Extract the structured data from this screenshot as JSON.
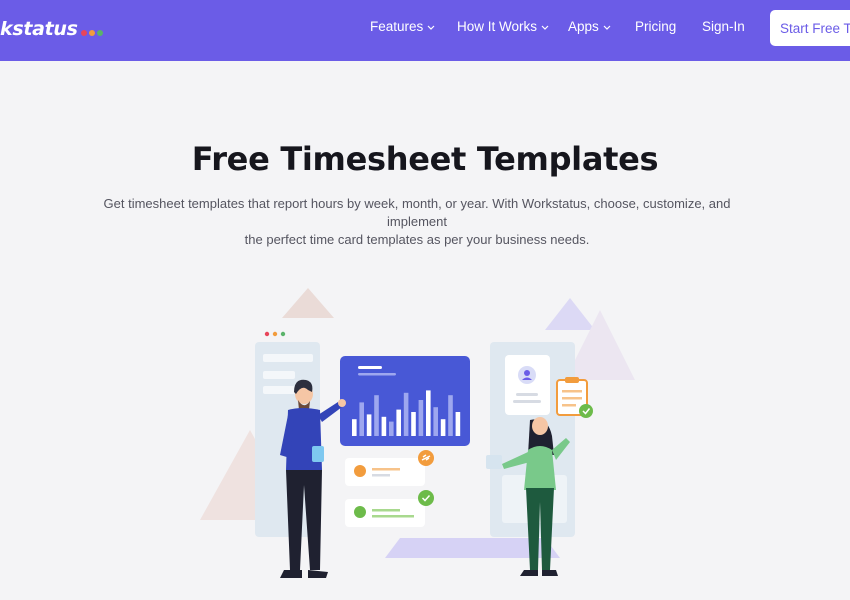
{
  "brand": {
    "name": "kstatus",
    "dot_colors": [
      "#e8455a",
      "#f29c3d",
      "#5ab36a"
    ]
  },
  "nav": {
    "items": [
      {
        "label": "Features",
        "has_dropdown": true
      },
      {
        "label": "How It Works",
        "has_dropdown": true
      },
      {
        "label": "Apps",
        "has_dropdown": true
      },
      {
        "label": "Pricing",
        "has_dropdown": false
      },
      {
        "label": "Sign-In",
        "has_dropdown": false
      }
    ],
    "cta_label": "Start Free Tr"
  },
  "hero": {
    "title": "Free Timesheet Templates",
    "subtitle_line1": "Get timesheet templates that report hours by week, month, or year. With Workstatus, choose, customize, and implement",
    "subtitle_line2": "the perfect time card templates as per your business needs."
  },
  "colors": {
    "brand_purple": "#6b5ce7",
    "chart_blue": "#4858d6",
    "accent_orange": "#f29c3d",
    "accent_green": "#6dbb4a"
  },
  "illustration": {
    "icons": [
      "bar-chart-card-icon",
      "man-figure",
      "woman-figure",
      "clipboard-icon",
      "link-badge-icon",
      "checkmark-badge-icon",
      "user-profile-icon"
    ],
    "chart_bar_levels": [
      0.35,
      0.7,
      0.45,
      0.85,
      0.4,
      0.3,
      0.55,
      0.9,
      0.5,
      0.75,
      0.95,
      0.6,
      0.35,
      0.85,
      0.5
    ]
  }
}
